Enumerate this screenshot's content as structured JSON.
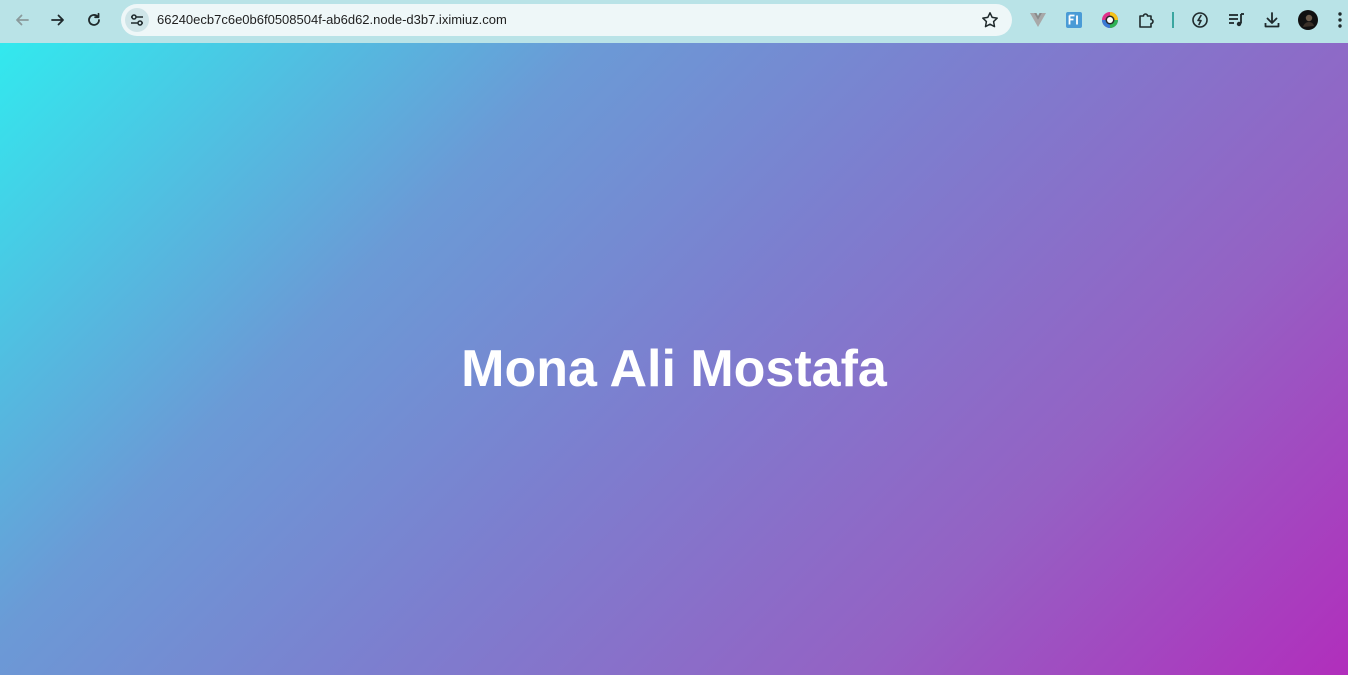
{
  "browser": {
    "url": "66240ecb7c6e0b6f0508504f-ab6d62.node-d3b7.iximiuz.com",
    "toolbar_color": "#b9e3e7",
    "extensions": [
      "vuejs-devtools-icon",
      "fi-extension-icon",
      "color-picker-icon",
      "extensions-puzzle-icon",
      "performance-icon",
      "media-controls-icon",
      "download-icon",
      "profile-avatar"
    ]
  },
  "page": {
    "title": "Mona Ali Mostafa",
    "gradient": {
      "start": "#32e9ee",
      "end": "#b12ebc"
    }
  }
}
